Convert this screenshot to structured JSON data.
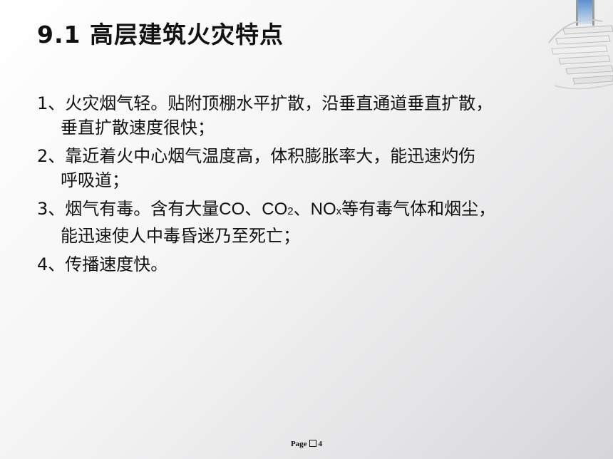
{
  "slide": {
    "title": "9.1 高层建筑火灾特点",
    "items": [
      {
        "line1": "1、火灾烟气轻。贴附顶棚水平扩散，沿垂直通道垂直扩散，",
        "line2": "垂直扩散速度很快；"
      },
      {
        "line1": "2、靠近着火中心烟气温度高，体积膨胀率大，能迅速灼伤",
        "line2": "呼吸道；"
      },
      {
        "line1_a": "3、烟气有毒。含有大量",
        "line1_co": "CO",
        "line1_sep": "、",
        "line1_co2": "CO",
        "line1_co2_sub": "2",
        "line1_sep2": "、",
        "line1_nox": "NO",
        "line1_nox_sub": "x",
        "line1_b": "等有毒气体和烟尘，",
        "line2": "能迅速使人中毒昏迷乃至死亡；"
      },
      {
        "line1": "4、传播速度快。"
      }
    ],
    "footer": {
      "page_label": "Page",
      "page_number": "4"
    }
  }
}
